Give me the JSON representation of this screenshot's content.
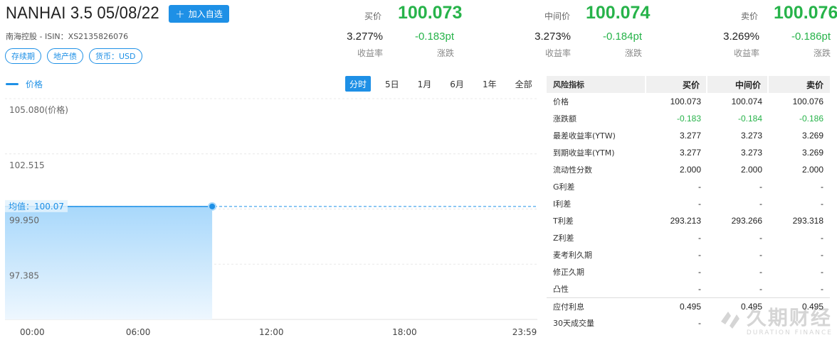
{
  "header": {
    "title": "NANHAI 3.5 05/08/22",
    "add_button": "加入自选",
    "subtitle": "南海控股 - ISIN：XS2135826076",
    "tags": [
      "存续期",
      "地产债",
      "货币：USD"
    ]
  },
  "quotes": [
    {
      "label": "买价",
      "price": "100.073",
      "yield": "3.277%",
      "yield_label": "收益率",
      "change": "-0.183pt",
      "change_label": "涨跌"
    },
    {
      "label": "中间价",
      "price": "100.074",
      "yield": "3.273%",
      "yield_label": "收益率",
      "change": "-0.184pt",
      "change_label": "涨跌"
    },
    {
      "label": "卖价",
      "price": "100.076",
      "yield": "3.269%",
      "yield_label": "收益率",
      "change": "-0.186pt",
      "change_label": "涨跌"
    }
  ],
  "chart_legend": "价格",
  "periods": [
    "分时",
    "5日",
    "1月",
    "6月",
    "1年",
    "全部"
  ],
  "active_period": "分时",
  "chart_data": {
    "type": "area",
    "y_ticks": [
      "105.080(价格)",
      "102.515",
      "99.950",
      "97.385"
    ],
    "y_tick_values": [
      105.08,
      102.515,
      99.95,
      97.385
    ],
    "ylim": [
      94.82,
      105.08
    ],
    "x_ticks": [
      "00:00",
      "06:00",
      "12:00",
      "18:00",
      "23:59"
    ],
    "x_tick_minutes": [
      0,
      360,
      720,
      1080,
      1439
    ],
    "xlim": [
      0,
      1439
    ],
    "avg_label": "均值：100.07",
    "avg_value": 100.07,
    "series": [
      {
        "x": [
          0,
          560
        ],
        "values": [
          100.07,
          100.07
        ]
      }
    ],
    "colors": {
      "line": "#1e90e6",
      "fill_top": "#a8d8fb",
      "fill_bottom": "#eef7fe",
      "avg": "#1e90e6"
    }
  },
  "risk_table": {
    "headers": [
      "风险指标",
      "买价",
      "中间价",
      "卖价"
    ],
    "rows": [
      {
        "name": "价格",
        "values": [
          "100.073",
          "100.074",
          "100.076"
        ]
      },
      {
        "name": "涨跌额",
        "values": [
          "-0.183",
          "-0.184",
          "-0.186"
        ]
      },
      {
        "name": "最差收益率(YTW)",
        "values": [
          "3.277",
          "3.273",
          "3.269"
        ]
      },
      {
        "name": "到期收益率(YTM)",
        "values": [
          "3.277",
          "3.273",
          "3.269"
        ]
      },
      {
        "name": "流动性分数",
        "values": [
          "2.000",
          "2.000",
          "2.000"
        ]
      },
      {
        "name": "G利差",
        "values": [
          "-",
          "-",
          "-"
        ]
      },
      {
        "name": "I利差",
        "values": [
          "-",
          "-",
          "-"
        ]
      },
      {
        "name": "T利差",
        "values": [
          "293.213",
          "293.266",
          "293.318"
        ]
      },
      {
        "name": "Z利差",
        "values": [
          "-",
          "-",
          "-"
        ]
      },
      {
        "name": "麦考利久期",
        "values": [
          "-",
          "-",
          "-"
        ]
      },
      {
        "name": "修正久期",
        "values": [
          "-",
          "-",
          "-"
        ]
      },
      {
        "name": "凸性",
        "values": [
          "-",
          "-",
          "-"
        ]
      },
      {
        "name": "应付利息",
        "values": [
          "0.495",
          "0.495",
          "0.495"
        ]
      },
      {
        "name": "30天成交量",
        "values": [
          "-",
          "",
          ""
        ]
      }
    ]
  },
  "watermark": {
    "cn": "久期财经",
    "en": "DURATION FINANCE"
  },
  "colors": {
    "accent": "#1e90e6",
    "down": "#27b34a"
  }
}
